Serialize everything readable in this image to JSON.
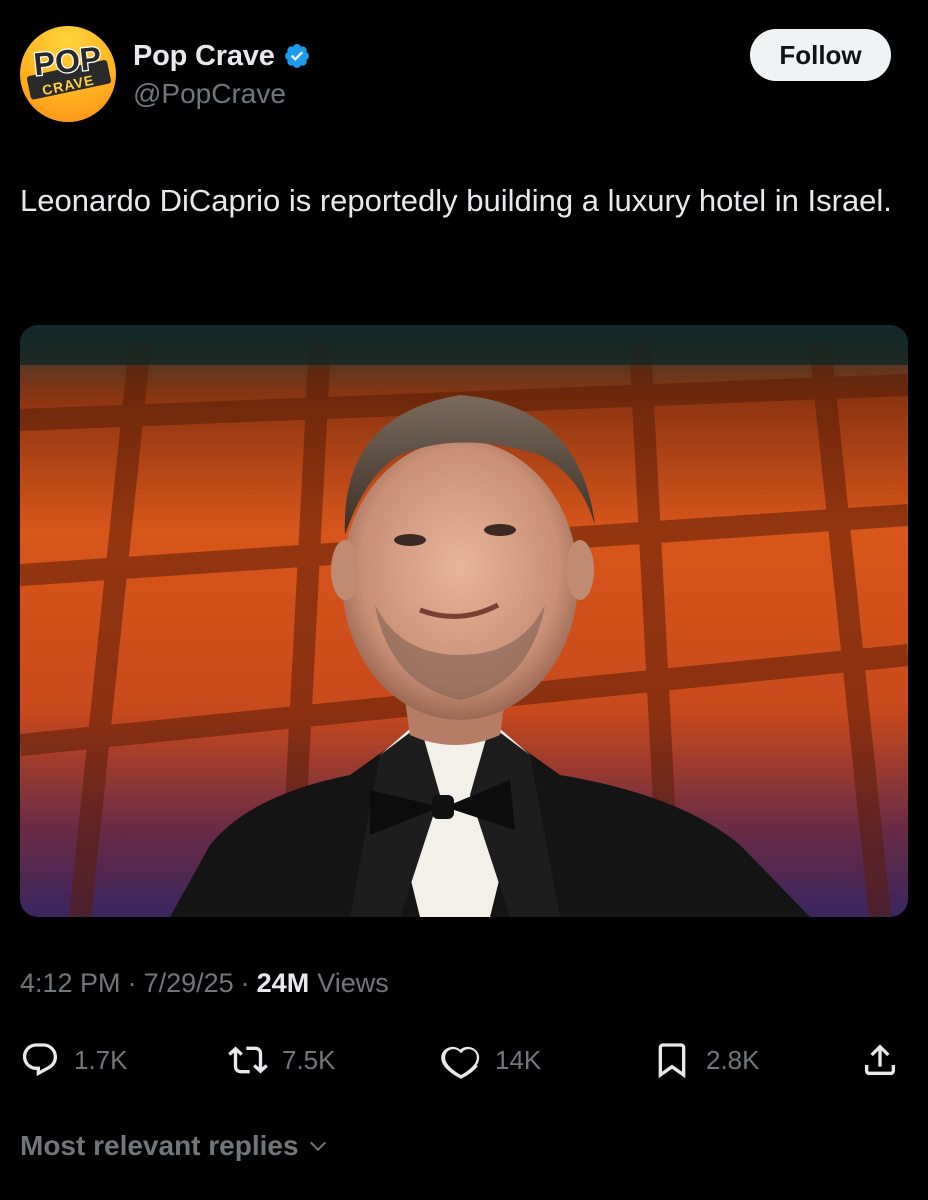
{
  "author": {
    "display_name": "Pop Crave",
    "handle": "@PopCrave",
    "verified": true,
    "avatar_logo_top": "POP",
    "avatar_logo_bottom": "CRAVE"
  },
  "follow_label": "Follow",
  "tweet": {
    "text": "Leonardo DiCaprio is reportedly building a luxury hotel in Israel."
  },
  "meta": {
    "time": "4:12 PM",
    "separator": "·",
    "date": "7/29/25",
    "views_count": "24M",
    "views_label": "Views"
  },
  "actions": {
    "replies": "1.7K",
    "reposts": "7.5K",
    "likes": "14K",
    "bookmarks": "2.8K"
  },
  "replies_sort_label": "Most relevant replies",
  "colors": {
    "background": "#000000",
    "text_primary": "#e7e9ea",
    "text_secondary": "#71767b",
    "verified_blue": "#1d9bf0",
    "follow_button_bg": "#eff3f4"
  },
  "icons": [
    "verified-badge-icon",
    "reply-icon",
    "repost-icon",
    "like-icon",
    "bookmark-icon",
    "share-icon",
    "chevron-down-icon"
  ]
}
